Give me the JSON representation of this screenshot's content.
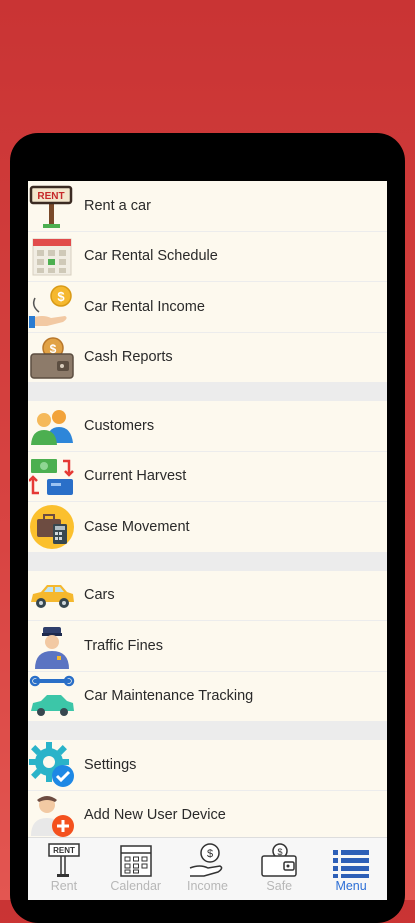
{
  "menu": {
    "groups": [
      [
        {
          "label": "Rent a car",
          "icon": "rent-sign-icon"
        },
        {
          "label": "Car Rental Schedule",
          "icon": "calendar-icon"
        },
        {
          "label": "Car Rental Income",
          "icon": "money-hand-icon"
        },
        {
          "label": "Cash Reports",
          "icon": "wallet-icon"
        }
      ],
      [
        {
          "label": "Customers",
          "icon": "users-icon"
        },
        {
          "label": "Current Harvest",
          "icon": "money-transfer-icon"
        },
        {
          "label": "Case Movement",
          "icon": "briefcase-calculator-icon"
        }
      ],
      [
        {
          "label": "Cars",
          "icon": "car-icon"
        },
        {
          "label": "Traffic Fines",
          "icon": "police-officer-icon"
        },
        {
          "label": "Car Maintenance Tracking",
          "icon": "car-wrench-icon"
        }
      ],
      [
        {
          "label": "Settings",
          "icon": "gear-check-icon"
        },
        {
          "label": "Add New User Device",
          "icon": "add-user-icon"
        }
      ]
    ]
  },
  "tabs": {
    "rent": "Rent",
    "calendar": "Calendar",
    "income": "Income",
    "safe": "Safe",
    "menu": "Menu",
    "active": "menu",
    "active_color": "#2d6fd6",
    "inactive_color": "#b7b7b7"
  }
}
